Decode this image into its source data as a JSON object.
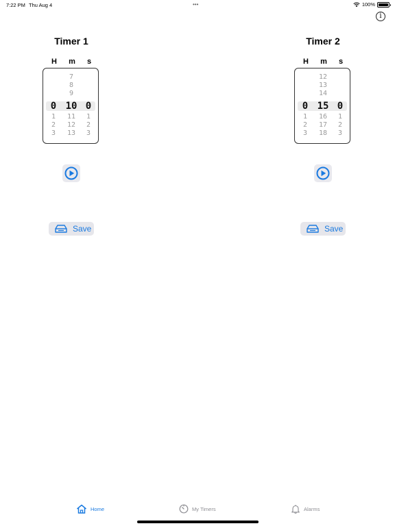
{
  "status_bar": {
    "time": "7:22 PM",
    "date": "Thu Aug 4",
    "dots": "•••",
    "battery": "100%"
  },
  "colors": {
    "accent": "#1a7ae0",
    "tab_inactive": "#8e8e93"
  },
  "timers": [
    {
      "title": "Timer 1",
      "labels": {
        "h": "H",
        "m": "m",
        "s": "s"
      },
      "hours": {
        "value": "0",
        "above": [],
        "below": [
          "1",
          "2",
          "3"
        ]
      },
      "minutes": {
        "value": "10",
        "above": [
          "7",
          "8",
          "9"
        ],
        "below": [
          "11",
          "12",
          "13"
        ]
      },
      "seconds": {
        "value": "0",
        "above": [],
        "below": [
          "1",
          "2",
          "3"
        ]
      },
      "play_icon": "play-circle-icon",
      "save_label": "Save"
    },
    {
      "title": "Timer 2",
      "labels": {
        "h": "H",
        "m": "m",
        "s": "s"
      },
      "hours": {
        "value": "0",
        "above": [],
        "below": [
          "1",
          "2",
          "3"
        ]
      },
      "minutes": {
        "value": "15",
        "above": [
          "12",
          "13",
          "14"
        ],
        "below": [
          "16",
          "17",
          "18"
        ]
      },
      "seconds": {
        "value": "0",
        "above": [],
        "below": [
          "1",
          "2",
          "3"
        ]
      },
      "play_icon": "play-circle-icon",
      "save_label": "Save"
    }
  ],
  "tabs": [
    {
      "label": "Home",
      "icon": "house-icon",
      "active": true
    },
    {
      "label": "My Timers",
      "icon": "timer-icon",
      "active": false
    },
    {
      "label": "Alarms",
      "icon": "bell-icon",
      "active": false
    }
  ]
}
